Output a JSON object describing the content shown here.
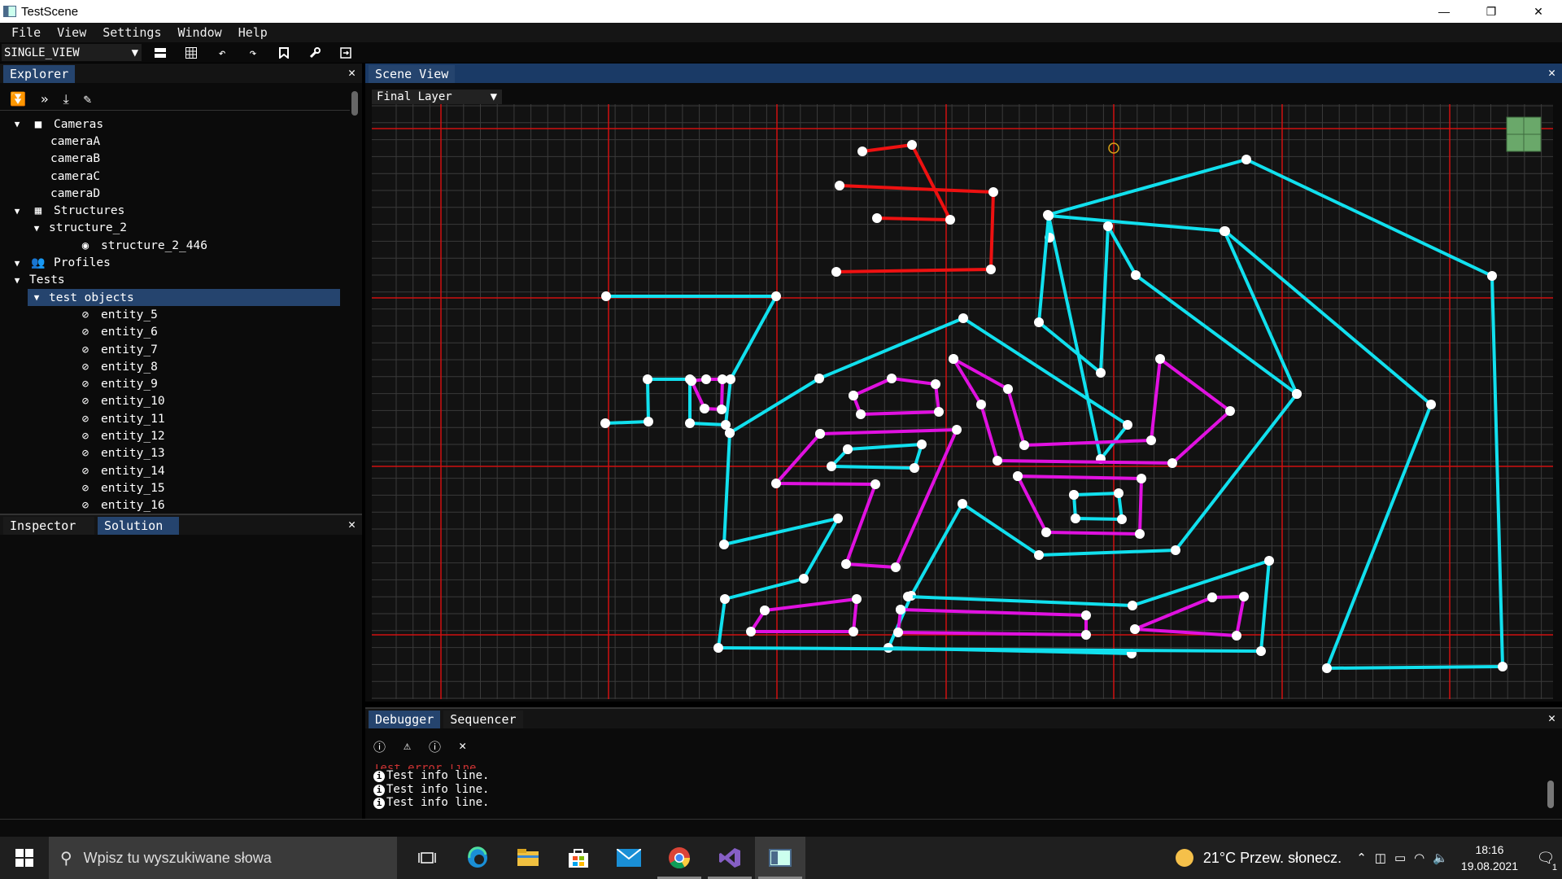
{
  "window": {
    "title": "TestScene",
    "minimize": "—",
    "restore": "❐",
    "close": "✕"
  },
  "menu": [
    "File",
    "View",
    "Settings",
    "Window",
    "Help"
  ],
  "toolbar": {
    "view_mode": "SINGLE_VIEW",
    "dropdown": "▼"
  },
  "explorer": {
    "tab": "Explorer",
    "tree": [
      {
        "label": "Cameras",
        "level": 0,
        "arrow": "▼",
        "icon": "camera-icon"
      },
      {
        "label": "cameraA",
        "level": 1
      },
      {
        "label": "cameraB",
        "level": 1
      },
      {
        "label": "cameraC",
        "level": 1
      },
      {
        "label": "cameraD",
        "level": 1
      },
      {
        "label": "Structures",
        "level": 0,
        "arrow": "▼",
        "icon": "building-icon"
      },
      {
        "label": "structure_2",
        "level": 1,
        "arrow": "▼"
      },
      {
        "label": "structure_2_446",
        "level": 2,
        "icon": "eye-icon"
      },
      {
        "label": "Profiles",
        "level": 0,
        "arrow": "▼",
        "icon": "users-icon"
      },
      {
        "label": "Tests",
        "level": 0,
        "arrow": "▼"
      },
      {
        "label": "test objects",
        "level": 1,
        "arrow": "▼",
        "selected": true
      },
      {
        "label": "entity_5",
        "level": 2,
        "icon": "eye-hidden-icon"
      },
      {
        "label": "entity_6",
        "level": 2,
        "icon": "eye-hidden-icon"
      },
      {
        "label": "entity_7",
        "level": 2,
        "icon": "eye-hidden-icon"
      },
      {
        "label": "entity_8",
        "level": 2,
        "icon": "eye-hidden-icon"
      },
      {
        "label": "entity_9",
        "level": 2,
        "icon": "eye-hidden-icon"
      },
      {
        "label": "entity_10",
        "level": 2,
        "icon": "eye-hidden-icon"
      },
      {
        "label": "entity_11",
        "level": 2,
        "icon": "eye-hidden-icon"
      },
      {
        "label": "entity_12",
        "level": 2,
        "icon": "eye-hidden-icon"
      },
      {
        "label": "entity_13",
        "level": 2,
        "icon": "eye-hidden-icon"
      },
      {
        "label": "entity_14",
        "level": 2,
        "icon": "eye-hidden-icon"
      },
      {
        "label": "entity_15",
        "level": 2,
        "icon": "eye-hidden-icon"
      },
      {
        "label": "entity_16",
        "level": 2,
        "icon": "eye-hidden-icon"
      }
    ]
  },
  "inspector": {
    "tabs": [
      "Inspector",
      "Solution"
    ],
    "active_tab": "Solution"
  },
  "scene": {
    "tab": "Scene View",
    "layer": "Final Layer",
    "colors": {
      "background": "#121212",
      "grid_minor": "#3a3a3a",
      "grid_major": "#d01010",
      "red": "#ee1111",
      "cyan": "#11e0ee",
      "magenta": "#e011e0",
      "vertex": "#ffffff"
    }
  },
  "debugger": {
    "tabs": [
      "Debugger",
      "Sequencer"
    ],
    "clipped_line": "Test error line.",
    "lines": [
      "Test info line.",
      "Test info line.",
      "Test info line."
    ]
  },
  "taskbar": {
    "search_placeholder": "Wpisz tu wyszukiwane słowa",
    "weather": "21°C  Przew. słonecz.",
    "time": "18:16",
    "date": "19.08.2021",
    "notifications": "1"
  }
}
